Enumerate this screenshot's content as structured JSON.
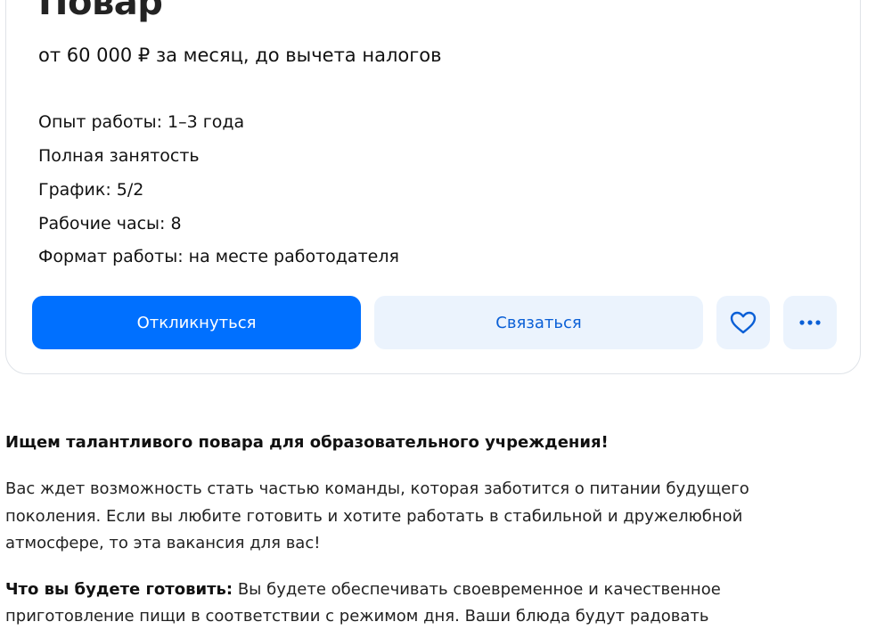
{
  "vacancy": {
    "title": "Повар",
    "salary": "от 60 000 ₽ за месяц, до вычета налогов",
    "specs": [
      "Опыт работы: 1–3 года",
      "Полная занятость",
      "График: 5/2",
      "Рабочие часы: 8",
      "Формат работы: на месте работодателя"
    ]
  },
  "actions": {
    "respond_label": "Откликнуться",
    "contact_label": "Связаться",
    "favorite_icon": "heart-icon",
    "more_icon": "more-dots-icon"
  },
  "description": {
    "heading": "Ищем талантливого повара для образовательного учреждения!",
    "intro_line1": "Вас ждет возможность стать частью команды, которая заботится о питании будущего",
    "intro_line2": "поколения. Если вы любите готовить и хотите работать в стабильной и дружелюбной",
    "intro_line3": "атмосфере, то эта вакансия для вас!",
    "cook_label": "Что вы будете готовить:",
    "cook_text": " Вы будете обеспечивать своевременное и качественное",
    "cook_text_line2": "приготовление пищи в соответствии с режимом дня. Ваши блюда будут радовать"
  },
  "colors": {
    "primary": "#0070ff",
    "secondary_bg": "#ebf3fd",
    "secondary_text": "#0a5fd6"
  }
}
